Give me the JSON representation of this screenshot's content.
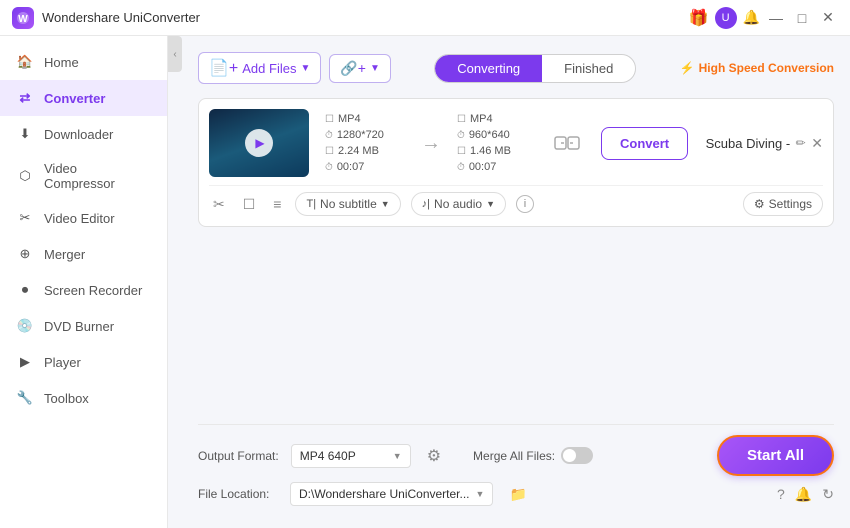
{
  "app": {
    "title": "Wondershare UniConverter",
    "logo_text": "W"
  },
  "titlebar": {
    "icons": {
      "gift": "🎁",
      "user": "U",
      "bell": "🔔",
      "minimize": "—",
      "maximize": "□",
      "close": "✕"
    }
  },
  "sidebar": {
    "items": [
      {
        "id": "home",
        "label": "Home",
        "active": false
      },
      {
        "id": "converter",
        "label": "Converter",
        "active": true
      },
      {
        "id": "downloader",
        "label": "Downloader",
        "active": false
      },
      {
        "id": "video-compressor",
        "label": "Video Compressor",
        "active": false
      },
      {
        "id": "video-editor",
        "label": "Video Editor",
        "active": false
      },
      {
        "id": "merger",
        "label": "Merger",
        "active": false
      },
      {
        "id": "screen-recorder",
        "label": "Screen Recorder",
        "active": false
      },
      {
        "id": "dvd-burner",
        "label": "DVD Burner",
        "active": false
      },
      {
        "id": "player",
        "label": "Player",
        "active": false
      },
      {
        "id": "toolbox",
        "label": "Toolbox",
        "active": false
      }
    ]
  },
  "topbar": {
    "add_files_label": "Add Files",
    "add_url_label": "Add URL",
    "tab_converting": "Converting",
    "tab_finished": "Finished",
    "speed_label": "High Speed Conversion"
  },
  "file_card": {
    "title": "Scuba Diving -",
    "source": {
      "format": "MP4",
      "resolution": "1280*720",
      "size": "2.24 MB",
      "duration": "00:07"
    },
    "target": {
      "format": "MP4",
      "resolution": "960*640",
      "size": "1.46 MB",
      "duration": "00:07"
    },
    "subtitle_label": "No subtitle",
    "audio_label": "No audio",
    "settings_label": "Settings",
    "convert_btn": "Convert"
  },
  "bottom": {
    "output_format_label": "Output Format:",
    "output_format_value": "MP4 640P",
    "file_location_label": "File Location:",
    "file_location_value": "D:\\Wondershare UniConverter...",
    "merge_files_label": "Merge All Files:",
    "start_all_label": "Start All"
  }
}
